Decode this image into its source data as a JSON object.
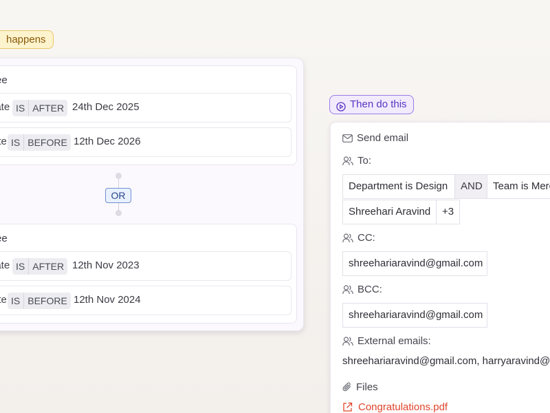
{
  "trigger": {
    "label": "happens"
  },
  "conditions": {
    "groups": [
      {
        "label": "ee",
        "rows": [
          {
            "field": "date",
            "op1": "IS",
            "op2": "AFTER",
            "value": "24th Dec 2025"
          },
          {
            "field": "ate",
            "op1": "IS",
            "op2": "BEFORE",
            "value": "12th Dec 2026"
          }
        ]
      },
      {
        "label": "ee",
        "rows": [
          {
            "field": "date",
            "op1": "IS",
            "op2": "AFTER",
            "value": "12th Nov 2023"
          },
          {
            "field": "ate",
            "op1": "IS",
            "op2": "BEFORE",
            "value": "12th Nov 2024"
          }
        ]
      }
    ],
    "connector": "OR"
  },
  "action": {
    "then_label": "Then do this",
    "title": "Send email",
    "to_label": "To:",
    "to": {
      "rule1": "Department is Design",
      "joiner": "AND",
      "rule2": "Team is Merc",
      "person": "Shreehari Aravind",
      "more": "+3"
    },
    "cc_label": "CC:",
    "cc": "shreehariaravind@gmail.com",
    "bcc_label": "BCC:",
    "bcc": "shreehariaravind@gmail.com",
    "external_label": "External emails:",
    "external": "shreehariaravind@gmail.com, harryaravind@g",
    "files_label": "Files",
    "file": "Congratulations.pdf"
  },
  "colors": {
    "trigger_bg": "#fdf3cd",
    "then_accent": "#5b33c2",
    "or_accent": "#24448b",
    "file_link": "#e0442a"
  },
  "icons": [
    "play-circle-icon",
    "mail-icon",
    "users-icon",
    "paperclip-icon",
    "external-link-icon"
  ]
}
